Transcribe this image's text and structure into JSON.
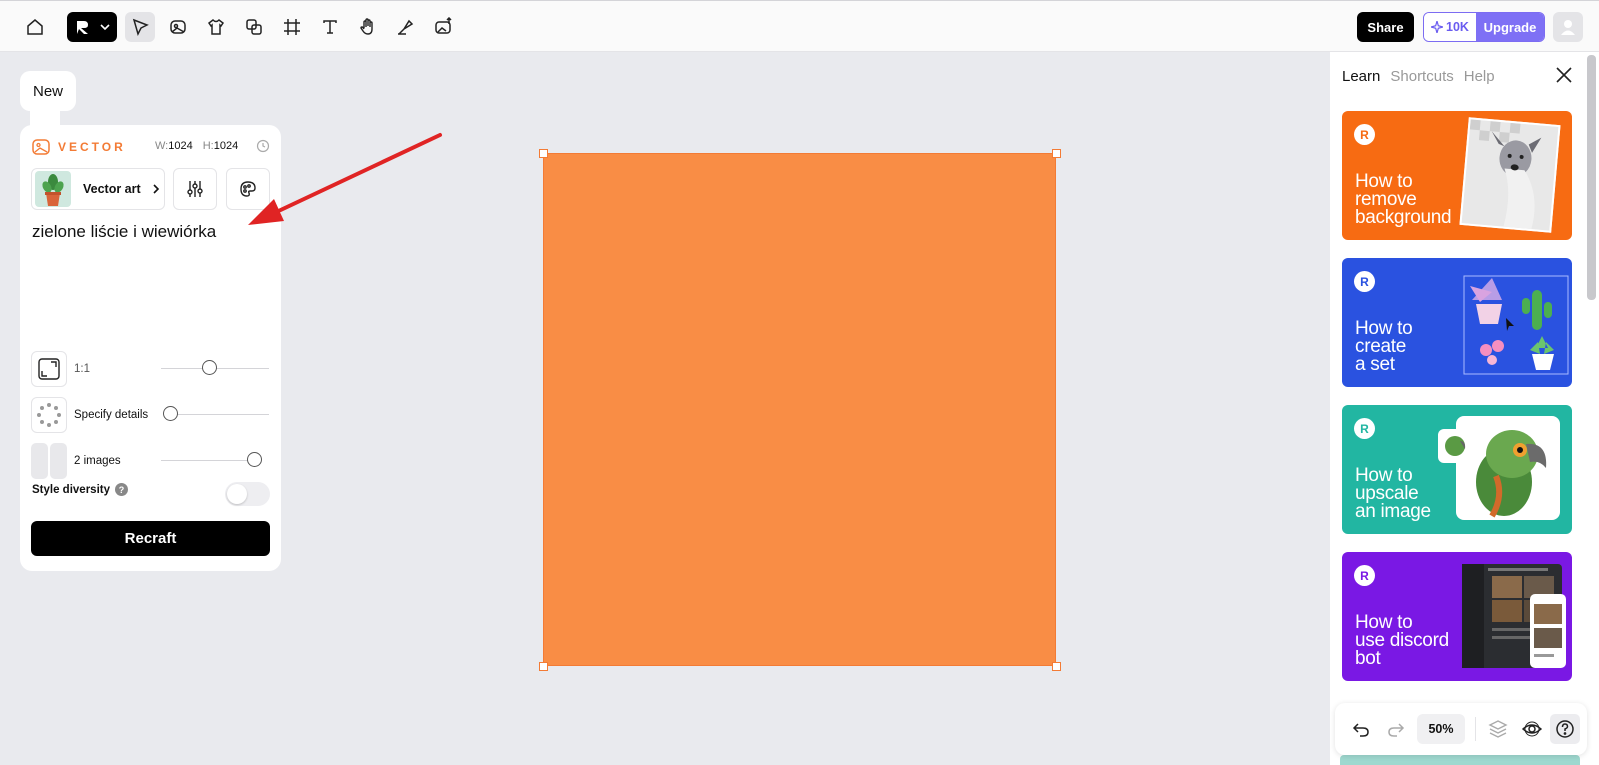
{
  "toolbar": {
    "share_label": "Share",
    "credits": "10K",
    "upgrade_label": "Upgrade"
  },
  "left_panel": {
    "new_tab_label": "New",
    "model_label": "VECTOR",
    "width_label": "W:",
    "width_value": "1024",
    "height_label": "H:",
    "height_value": "1024",
    "style_name": "Vector art",
    "prompt": "zielone liście i wiewiórka",
    "aspect_label": "1:1",
    "details_label": "Specify details",
    "images_label": "2 images",
    "diversity_label": "Style diversity",
    "diversity_on": false,
    "recraft_label": "Recraft"
  },
  "canvas": {
    "fill_color": "#f98d45",
    "border_color": "#f37b35"
  },
  "right_panel": {
    "tabs": [
      {
        "label": "Learn",
        "active": true
      },
      {
        "label": "Shortcuts",
        "active": false
      },
      {
        "label": "Help",
        "active": false
      }
    ],
    "cards": [
      {
        "title": "How to remove background",
        "color": "#f76b12"
      },
      {
        "title": "How to create a set",
        "color": "#2a52e0"
      },
      {
        "title": "How to upscale an image",
        "color": "#22b6a2"
      },
      {
        "title": "How to use discord bot",
        "color": "#7a18e4"
      }
    ]
  },
  "bottom_bar": {
    "zoom": "50%"
  },
  "annotation": {
    "arrow_color": "#e02424"
  }
}
